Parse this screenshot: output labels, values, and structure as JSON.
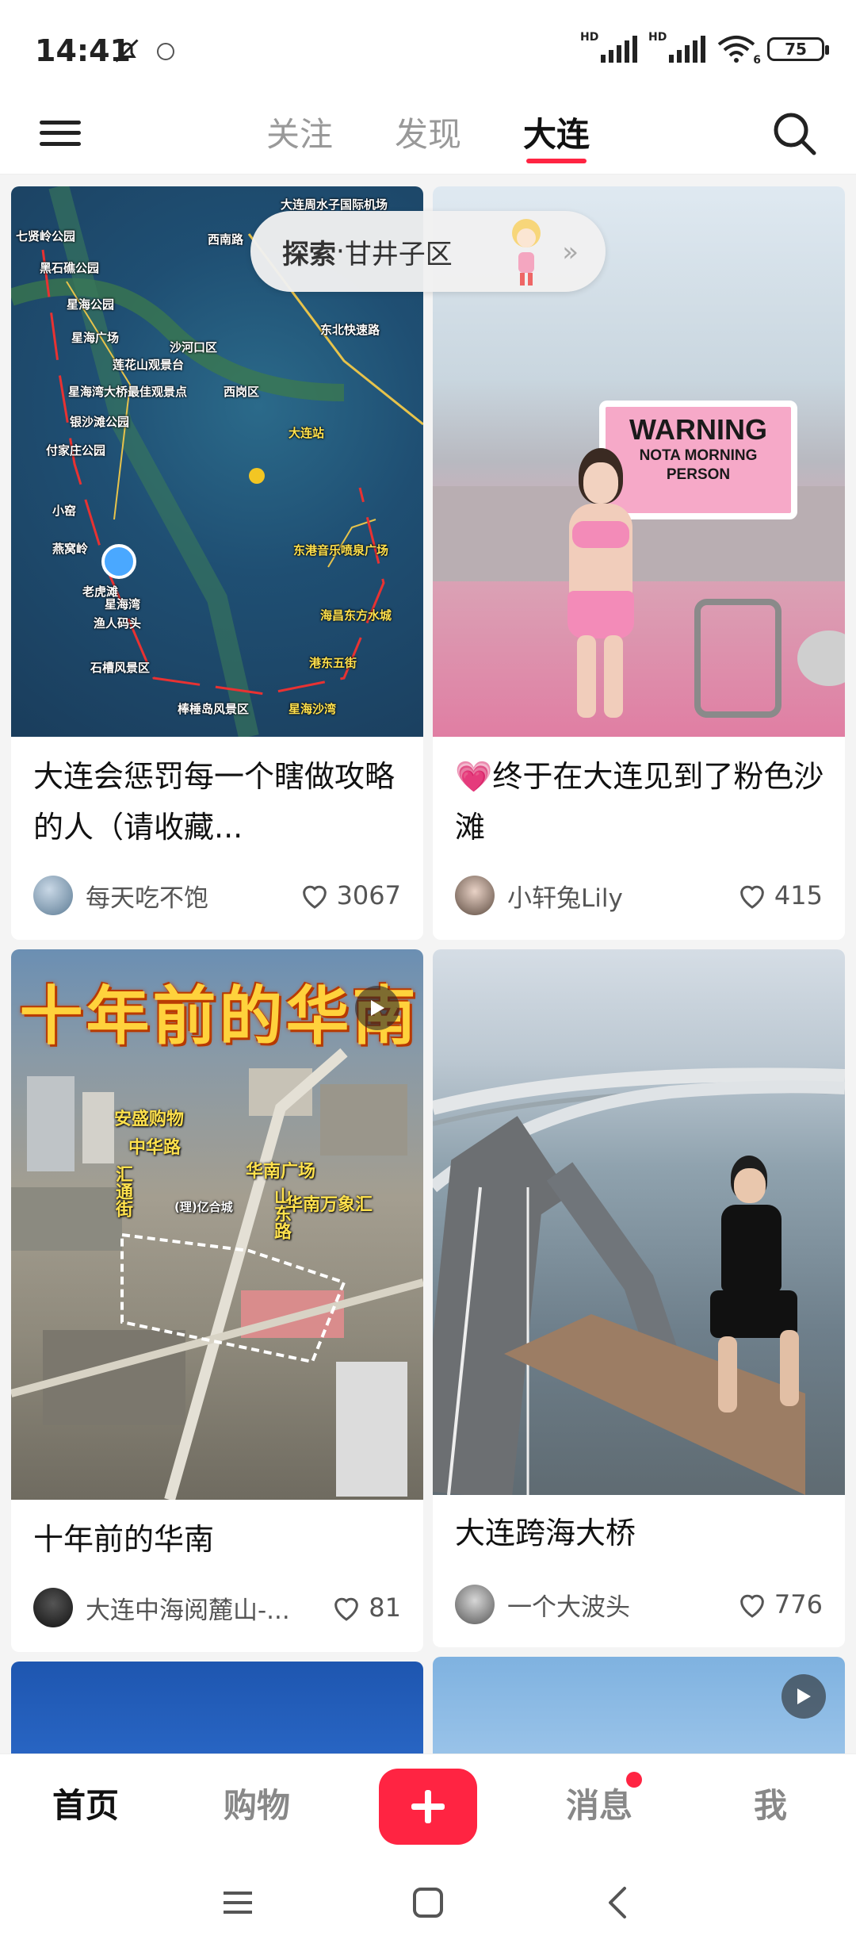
{
  "status_bar": {
    "time": "14:41",
    "battery": "75",
    "sim1_label": "HD",
    "sim2_label": "HD",
    "wifi_label": "6"
  },
  "top_nav": {
    "tabs": [
      {
        "label": "关注"
      },
      {
        "label": "发现"
      },
      {
        "label": "大连",
        "active": true
      }
    ]
  },
  "explore": {
    "prefix": "探索",
    "separator": " · ",
    "location": "甘井子区"
  },
  "feed": {
    "cards": [
      {
        "title": "大连会惩罚每一个瞎做攻略的人（请收藏...",
        "author": "每天吃不饱",
        "likes": "3067",
        "image": "map"
      },
      {
        "title": "💗终于在大连见到了粉色沙滩",
        "author": "小轩兔Lily",
        "likes": "415",
        "image": "pink-beach",
        "sign_line1": "WARNING",
        "sign_line2": "NOTA MORNING",
        "sign_line3": "PERSON"
      },
      {
        "title": "十年前的华南",
        "author": "大连中海阅麓山-...",
        "likes": "81",
        "image": "aerial-city",
        "overlay_title": "十年前的华南",
        "is_video": true
      },
      {
        "title": "大连跨海大桥",
        "author": "一个大波头",
        "likes": "776",
        "image": "sea-bridge"
      }
    ],
    "map_labels": [
      "七贤岭公园",
      "黑石礁公园",
      "星海公园",
      "星海广场",
      "莲花山观景台",
      "星海湾大桥最佳观景点",
      "银沙滩公园",
      "付家庄公园",
      "小窑",
      "燕窝岭",
      "老虎滩",
      "渔人码头",
      "石槽风景区",
      "棒棰岛风景区",
      "星海湾",
      "西南路",
      "东北快速路",
      "沙河口区",
      "西岗区",
      "大连站",
      "东港音乐喷泉广场",
      "港东五街",
      "海昌东方水城",
      "星海沙湾",
      "大连周水子国际机场"
    ],
    "city_labels": [
      "安盛购物",
      "中华路",
      "汇通街",
      "华南广场",
      "山东路",
      "华南万象汇",
      "(理)亿合城"
    ]
  },
  "bottom_bar": {
    "home": "首页",
    "shop": "购物",
    "messages": "消息",
    "me": "我"
  }
}
